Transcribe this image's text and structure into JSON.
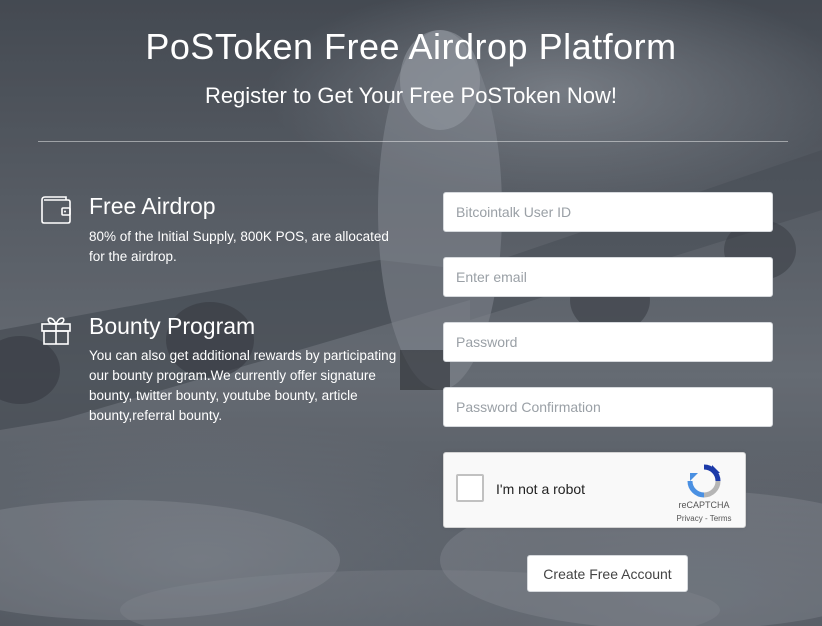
{
  "header": {
    "title": "PoSToken Free Airdrop Platform",
    "subtitle": "Register to Get Your Free PoSToken Now!"
  },
  "features": [
    {
      "icon": "wallet-icon",
      "heading": "Free Airdrop",
      "body": "80% of the Initial Supply, 800K POS, are allocated for the airdrop."
    },
    {
      "icon": "gift-icon",
      "heading": "Bounty Program",
      "body": "You can also get additional rewards by participating our bounty program.We currently offer signature bounty, twitter bounty, youtube bounty, article bounty,referral bounty."
    }
  ],
  "form": {
    "user_id_placeholder": "Bitcointalk User ID",
    "email_placeholder": "Enter email",
    "password_placeholder": "Password",
    "password_confirm_placeholder": "Password Confirmation",
    "captcha": {
      "label": "I'm not a robot",
      "brand": "reCAPTCHA",
      "privacy": "Privacy",
      "separator": " - ",
      "terms": "Terms"
    },
    "submit_label": "Create Free Account"
  },
  "colors": {
    "text": "#ffffff",
    "field_bg": "#ffffff",
    "recaptcha_blue": "#4a90e2",
    "recaptcha_gray": "#b5b5b5"
  }
}
